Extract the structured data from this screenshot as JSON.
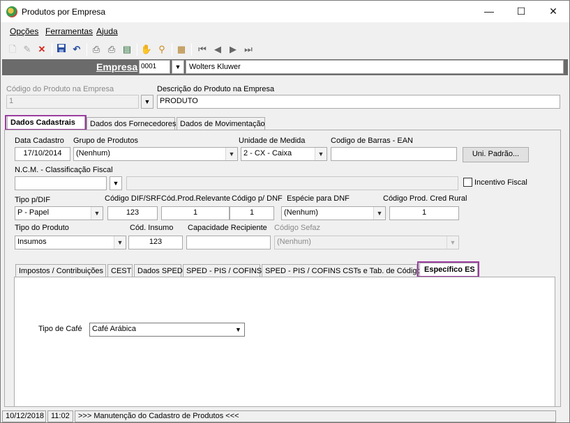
{
  "window": {
    "title": "Produtos por Empresa",
    "minimize": "—",
    "maximize": "☐",
    "close": "✕"
  },
  "menu": [
    {
      "label": "Opções"
    },
    {
      "label": "Ferramentas"
    },
    {
      "label": "Ajuda"
    }
  ],
  "toolbar": {
    "icons": [
      "new-icon",
      "edit-icon",
      "delete-icon",
      "save-icon",
      "undo-icon",
      "print-icon",
      "print-preview-icon",
      "export-icon",
      "hand-icon",
      "search-icon",
      "settings-icon",
      "first-icon",
      "prev-icon",
      "next-icon",
      "last-icon"
    ]
  },
  "empresa": {
    "label": "Empresa",
    "code": "0001",
    "name": "Wolters Kluwer"
  },
  "produto": {
    "codigo_label": "Código do Produto na Empresa",
    "codigo_value": "1",
    "descricao_label": "Descrição do Produto na Empresa",
    "descricao_value": "PRODUTO"
  },
  "main_tabs": [
    {
      "label": "Dados Cadastrais"
    },
    {
      "label": "Dados dos Fornecedores"
    },
    {
      "label": "Dados de Movimentação"
    }
  ],
  "form": {
    "data_cadastro_label": "Data Cadastro",
    "data_cadastro_value": "17/10/2014",
    "grupo_label": "Grupo de Produtos",
    "grupo_value": "(Nenhum)",
    "unidade_label": "Unidade de Medida",
    "unidade_value": "2 - CX - Caixa",
    "ean_label": "Codigo de Barras - EAN",
    "ean_value": "",
    "uni_padrao_button": "Uni. Padrão...",
    "ncm_label": "N.C.M. -  Classificação Fiscal",
    "ncm_value": "",
    "ncm_desc": "",
    "incentivo_label": "Incentivo Fiscal",
    "tipo_dif_label": "Tipo p/DIF",
    "tipo_dif_value": "P - Papel",
    "cod_dif_label": "Código DIF/SRF",
    "cod_dif_value": "123",
    "cod_relevante_label": "Cód.Prod.Relevante",
    "cod_relevante_value": "1",
    "cod_dnf_label": "Código p/ DNF",
    "cod_dnf_value": "1",
    "especie_label": "Espécie para DNF",
    "especie_value": "(Nenhum)",
    "cod_rural_label": "Código Prod. Cred Rural",
    "cod_rural_value": "1",
    "tipo_produto_label": "Tipo do Produto",
    "tipo_produto_value": "Insumos",
    "cod_insumo_label": "Cód. Insumo",
    "cod_insumo_value": "123",
    "capacidade_label": "Capacidade Recipiente",
    "capacidade_value": "",
    "sefaz_label": "Código Sefaz",
    "sefaz_value": "(Nenhum)"
  },
  "sub_tabs": [
    {
      "label": "Impostos / Contribuições"
    },
    {
      "label": "CEST"
    },
    {
      "label": "Dados SPED"
    },
    {
      "label": "SPED - PIS / COFINS"
    },
    {
      "label": "SPED - PIS / COFINS CSTs e Tab. de Códigos"
    },
    {
      "label": "Específico ES"
    }
  ],
  "especifico": {
    "tipo_cafe_label": "Tipo de Café",
    "tipo_cafe_value": "Café Arábica"
  },
  "status": {
    "date": "10/12/2018",
    "time": "11:02",
    "message": ">>> Manutenção do Cadastro de Produtos <<<"
  },
  "colors": {
    "highlight": "#9b3d9f",
    "empresa_bar": "#6b6b6b"
  }
}
